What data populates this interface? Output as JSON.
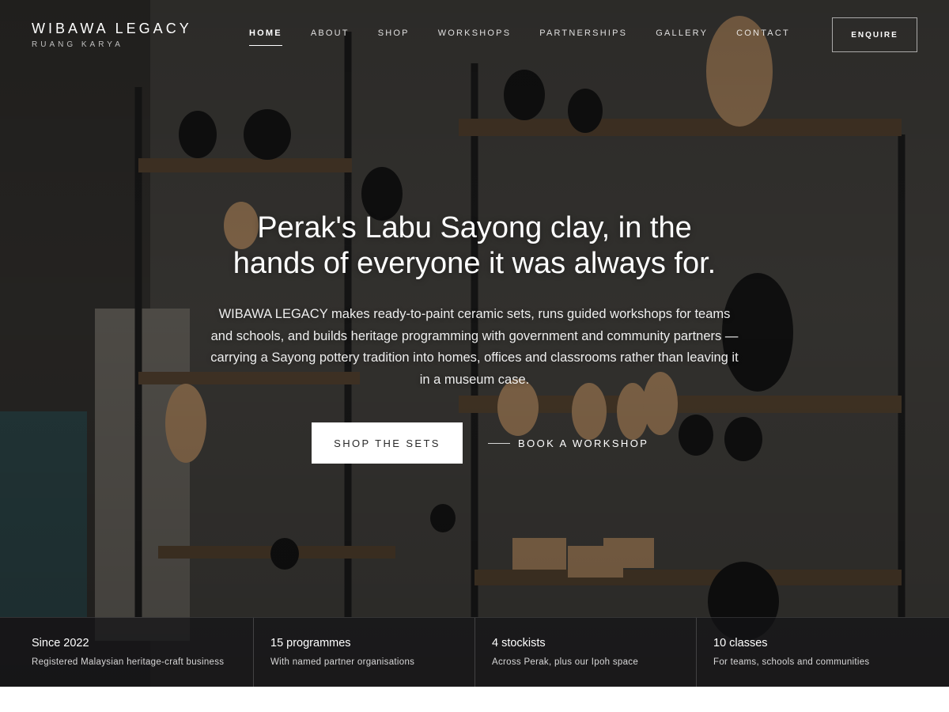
{
  "brand": {
    "name": "WIBAWA LEGACY",
    "tagline": "RUANG KARYA"
  },
  "nav": {
    "items": [
      {
        "label": "HOME",
        "active": true
      },
      {
        "label": "ABOUT",
        "active": false
      },
      {
        "label": "SHOP",
        "active": false
      },
      {
        "label": "WORKSHOPS",
        "active": false
      },
      {
        "label": "PARTNERSHIPS",
        "active": false
      },
      {
        "label": "GALLERY",
        "active": false
      },
      {
        "label": "CONTACT",
        "active": false
      }
    ],
    "cta_label": "ENQUIRE"
  },
  "hero": {
    "headline_line1": "Perak's Labu Sayong clay, in the",
    "headline_line2": "hands of everyone it was always for.",
    "lede": "WIBAWA LEGACY makes ready-to-paint ceramic sets, runs guided workshops for teams and schools, and builds heritage programming with government and community partners — carrying a Sayong pottery tradition into homes, offices and classrooms rather than leaving it in a museum case.",
    "primary_cta": "SHOP THE SETS",
    "secondary_cta": "BOOK A WORKSHOP"
  },
  "stats": [
    {
      "title": "Since 2022",
      "desc": "Registered Malaysian heritage-craft business"
    },
    {
      "title": "15 programmes",
      "desc": "With named partner organisations"
    },
    {
      "title": "4 stockists",
      "desc": "Across Perak, plus our Ipoh space"
    },
    {
      "title": "10 classes",
      "desc": "For teams, schools and communities"
    }
  ],
  "colors": {
    "overlay": "#2b2a28",
    "primary_button_bg": "#ffffff",
    "primary_button_text": "#2a2a2a",
    "stats_bg": "#141416"
  }
}
